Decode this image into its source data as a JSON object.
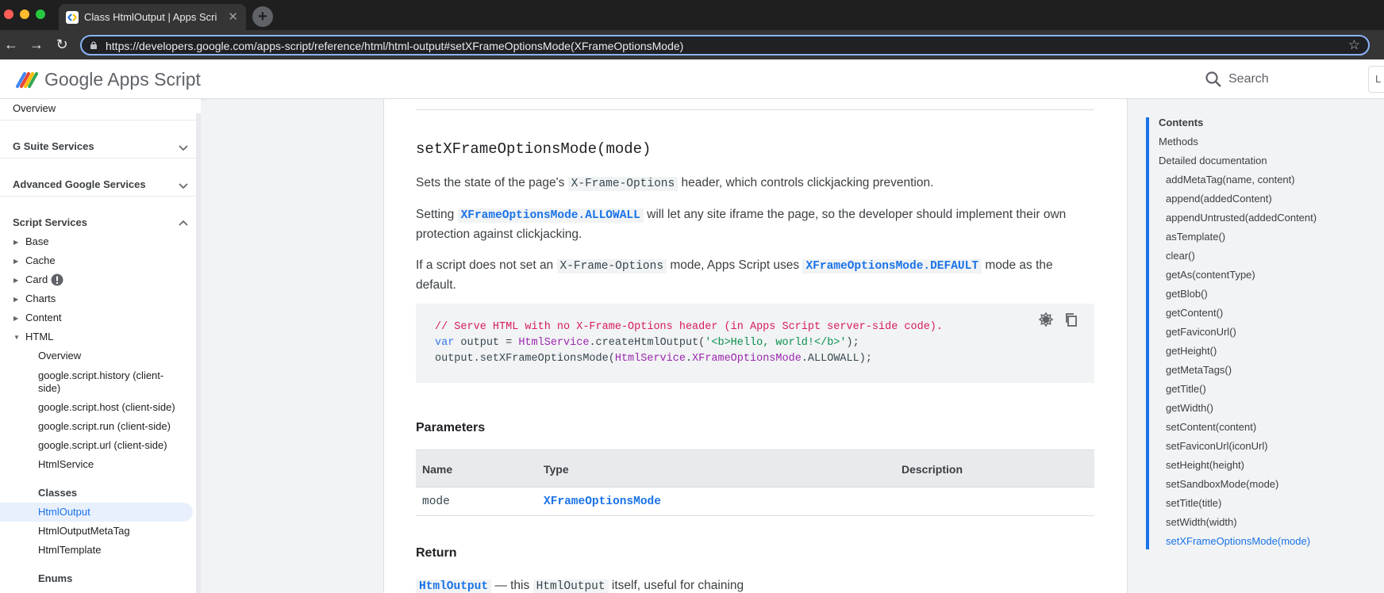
{
  "browser": {
    "tab_title": "Class HtmlOutput  |  Apps Scri",
    "url": "https://developers.google.com/apps-script/reference/html/html-output#setXFrameOptionsMode(XFrameOptionsMode)"
  },
  "header": {
    "brand_google": "Google",
    "brand_product": "Apps Script",
    "search_placeholder": "Search",
    "lang": "L"
  },
  "sidebar": {
    "overview": "Overview",
    "gsuite": "G Suite Services",
    "advanced": "Advanced Google Services",
    "script_services": "Script Services",
    "base": "Base",
    "cache": "Cache",
    "card": "Card",
    "charts": "Charts",
    "content": "Content",
    "html": "HTML",
    "html_items": [
      "Overview",
      "google.script.history (client-",
      "side)",
      "google.script.host (client-side)",
      "google.script.run (client-side)",
      "google.script.url (client-side)",
      "HtmlService"
    ],
    "classes_head": "Classes",
    "classes": [
      "HtmlOutput",
      "HtmlOutputMetaTag",
      "HtmlTemplate"
    ],
    "enums_head": "Enums"
  },
  "main": {
    "method_title": "setXFrameOptionsMode(mode)",
    "p1_a": "Sets the state of the page's ",
    "p1_code": "X-Frame-Options",
    "p1_b": " header, which controls clickjacking prevention.",
    "p2_a": "Setting ",
    "p2_code": "XFrameOptionsMode.ALLOWALL",
    "p2_b": " will let any site iframe the page, so the developer should implement their own",
    "p2_c": "protection against clickjacking.",
    "p3_a": "If a script does not set an ",
    "p3_code1": "X-Frame-Options",
    "p3_b": " mode, Apps Script uses ",
    "p3_code2": "XFrameOptionsMode.DEFAULT",
    "p3_c": " mode as the",
    "p3_d": "default.",
    "code": {
      "line1": "// Serve HTML with no X-Frame-Options header (in Apps Script server-side code).",
      "l2_kw": "var",
      "l2_a": " output = ",
      "l2_cls": "HtmlService",
      "l2_b": ".createHtmlOutput(",
      "l2_str": "'<b>Hello, world!</b>'",
      "l2_c": ");",
      "l3_a": "output.setXFrameOptionsMode(",
      "l3_cls1": "HtmlService",
      "l3_dot": ".",
      "l3_cls2": "XFrameOptionsMode",
      "l3_b": ".ALLOWALL);"
    },
    "params_head": "Parameters",
    "table": {
      "headers": [
        "Name",
        "Type",
        "Description"
      ],
      "row": {
        "name": "mode",
        "type": "XFrameOptionsMode",
        "description": ""
      }
    },
    "return_head": "Return",
    "ret_type": "HtmlOutput",
    "ret_a": " — this ",
    "ret_code": "HtmlOutput",
    "ret_b": " itself, useful for chaining"
  },
  "toc": {
    "items": [
      "Contents",
      "Methods",
      "Detailed documentation",
      "addMetaTag(name, content)",
      "append(addedContent)",
      "appendUntrusted(addedContent)",
      "asTemplate()",
      "clear()",
      "getAs(contentType)",
      "getBlob()",
      "getContent()",
      "getFaviconUrl()",
      "getHeight()",
      "getMetaTags()",
      "getTitle()",
      "getWidth()",
      "setContent(content)",
      "setFaviconUrl(iconUrl)",
      "setHeight(height)",
      "setSandboxMode(mode)",
      "setTitle(title)",
      "setWidth(width)",
      "setXFrameOptionsMode(mode)"
    ]
  },
  "colors": {
    "accent": "#1a73e8",
    "selected_bg": "#e8f0fe"
  }
}
